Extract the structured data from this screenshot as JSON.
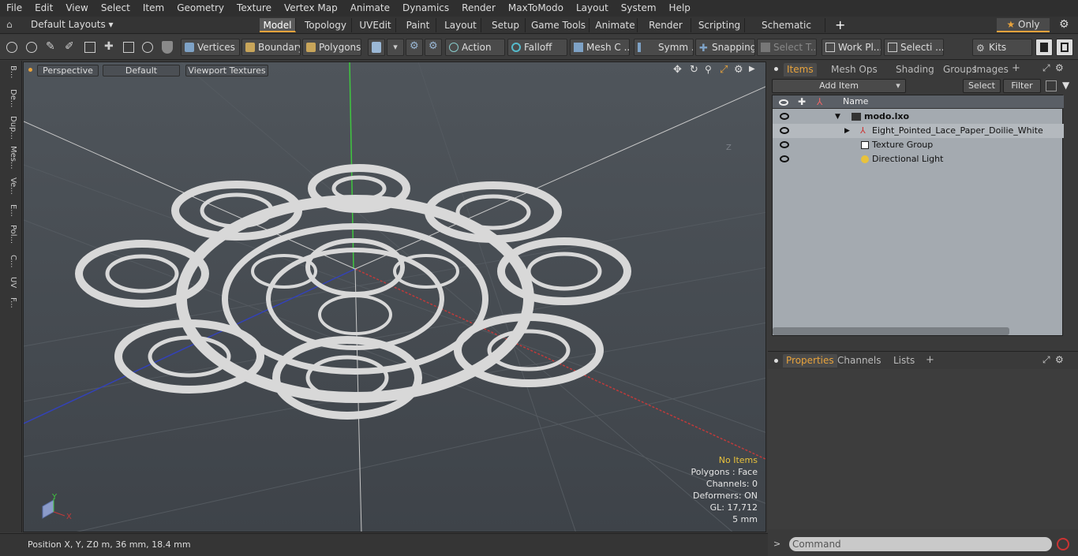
{
  "menubar": [
    "File",
    "Edit",
    "View",
    "Select",
    "Item",
    "Geometry",
    "Texture",
    "Vertex Map",
    "Animate",
    "Dynamics",
    "Render",
    "MaxToModo",
    "Layout",
    "System",
    "Help"
  ],
  "layoutbar": {
    "layouts_label": "Default Layouts",
    "tabs": [
      "Model",
      "Topology",
      "UVEdit",
      "Paint",
      "Layout",
      "Setup",
      "Game Tools",
      "Animate",
      "Render",
      "Scripting",
      "Schematic Fusion"
    ],
    "only_label": "Only"
  },
  "toolbar": {
    "vertices": "Vertices",
    "boundary": "Boundary",
    "polygons": "Polygons",
    "action": "Action",
    "falloff": "Falloff",
    "mesh": "Mesh C ...",
    "symm": "Symm ...",
    "snapping": "Snapping",
    "select_t": "Select T...",
    "work_plane": "Work Pl...",
    "selection": "Selecti ...",
    "kits": "Kits"
  },
  "lefttabs": [
    "B...",
    "De...",
    "Dup...",
    "Mes...",
    "Ve...",
    "E...",
    "Pol...",
    "C...",
    "UV",
    "F..."
  ],
  "viewport": {
    "perspective": "Perspective",
    "default": "Default",
    "textures": "Viewport Textures",
    "info": [
      "No Items",
      "Polygons : Face",
      "Channels: 0",
      "Deformers: ON",
      "GL: 17,712",
      "5 mm"
    ],
    "axis_x": "X",
    "axis_y": "Y",
    "axis_z": "Z"
  },
  "statusbar": {
    "position_label": "Position X, Y, Z:",
    "position_value": "0 m, 36 mm, 18.4 mm"
  },
  "items_panel": {
    "tabs": [
      "Items",
      "Mesh Ops",
      "Shading",
      "Groups",
      "Images"
    ],
    "add_item": "Add Item",
    "select": "Select",
    "filter": "Filter",
    "name_header": "Name",
    "items": [
      "modo.lxo",
      "Eight_Pointed_Lace_Paper_Doilie_White",
      "Texture Group",
      "Directional Light"
    ]
  },
  "props_panel": {
    "tabs": [
      "Properties",
      "Channels",
      "Lists"
    ]
  },
  "command": {
    "placeholder": "Command"
  },
  "colors": {
    "accent": "#e8a33c",
    "list_bg": "#a4aab0"
  }
}
